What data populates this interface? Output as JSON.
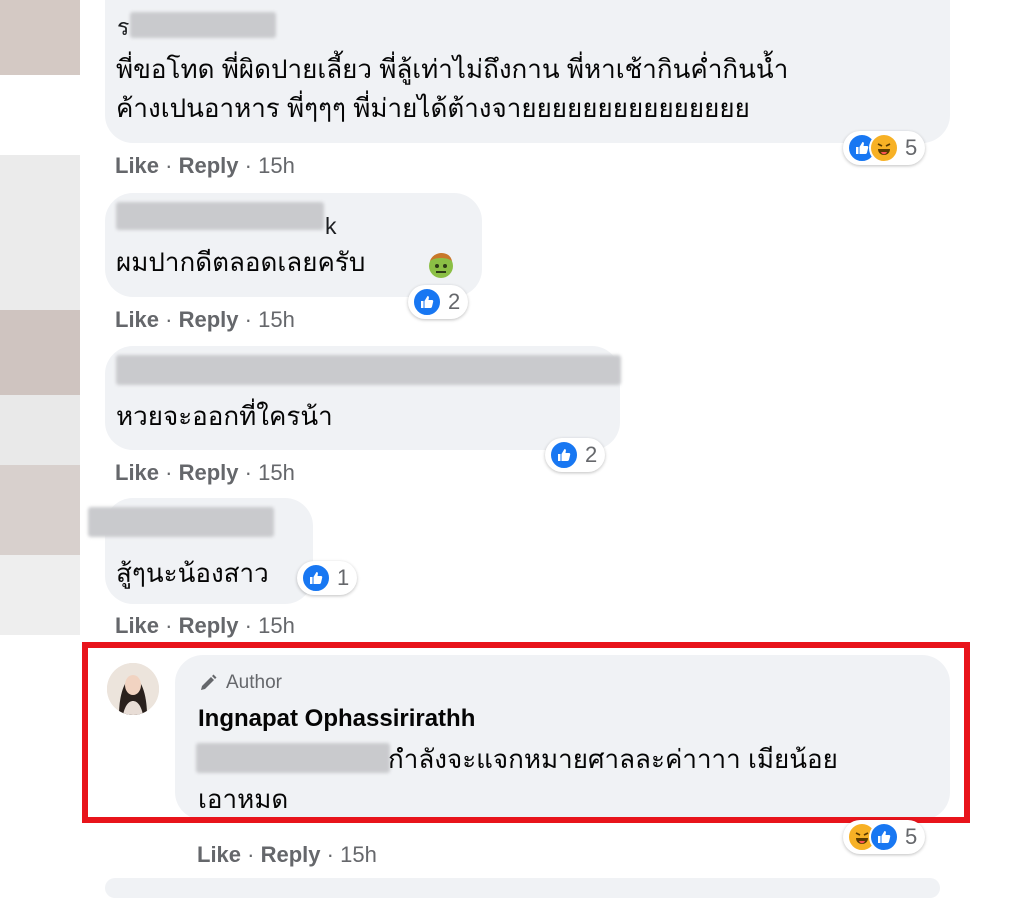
{
  "comments": [
    {
      "name_fragment": "ร",
      "text_lines": [
        "พี่ขอโทด พี่ผิดปายเลี้ยว พี่ลู้เท่าไม่ถึงกาน พี่หาเช้ากินค่ำกินน้ำ",
        "ค้างเปนอาหาร พี่ๆๆๆ พี่ม่ายได้ต้างจายยยยยยยยยยยยยยย"
      ],
      "reactions": [
        "like",
        "haha"
      ],
      "reaction_count": "5",
      "like": "Like",
      "reply": "Reply",
      "time": "15h"
    },
    {
      "name_fragment": "k",
      "text_lines": [
        "ผมปากดีตลอดเลยครับ"
      ],
      "emoji": "zombie-emoji",
      "reactions": [
        "like"
      ],
      "reaction_count": "2",
      "like": "Like",
      "reply": "Reply",
      "time": "15h"
    },
    {
      "text_lines": [
        "หวยจะออกที่ใครน้า"
      ],
      "reactions": [
        "like"
      ],
      "reaction_count": "2",
      "like": "Like",
      "reply": "Reply",
      "time": "15h"
    },
    {
      "text_lines": [
        "สู้ๆนะน้องสาว"
      ],
      "reactions": [
        "like"
      ],
      "reaction_count": "1",
      "like": "Like",
      "reply": "Reply",
      "time": "15h"
    }
  ],
  "author_comment": {
    "tag": "Author",
    "name": "Ingnapat Ophassirirathh",
    "text_line1": "กำลังจะแจกหมายศาลละค่าาาา เมียน้อย",
    "text_line2": "เอาหมด",
    "reactions": [
      "haha",
      "like"
    ],
    "reaction_count": "5",
    "like": "Like",
    "reply": "Reply",
    "time": "15h"
  },
  "colors": {
    "bubble": "#f0f2f5",
    "like_blue": "#1877f2",
    "haha_yellow": "#f7b125",
    "highlight_red": "#e8141b",
    "meta_gray": "#65676b"
  },
  "separator": "·"
}
